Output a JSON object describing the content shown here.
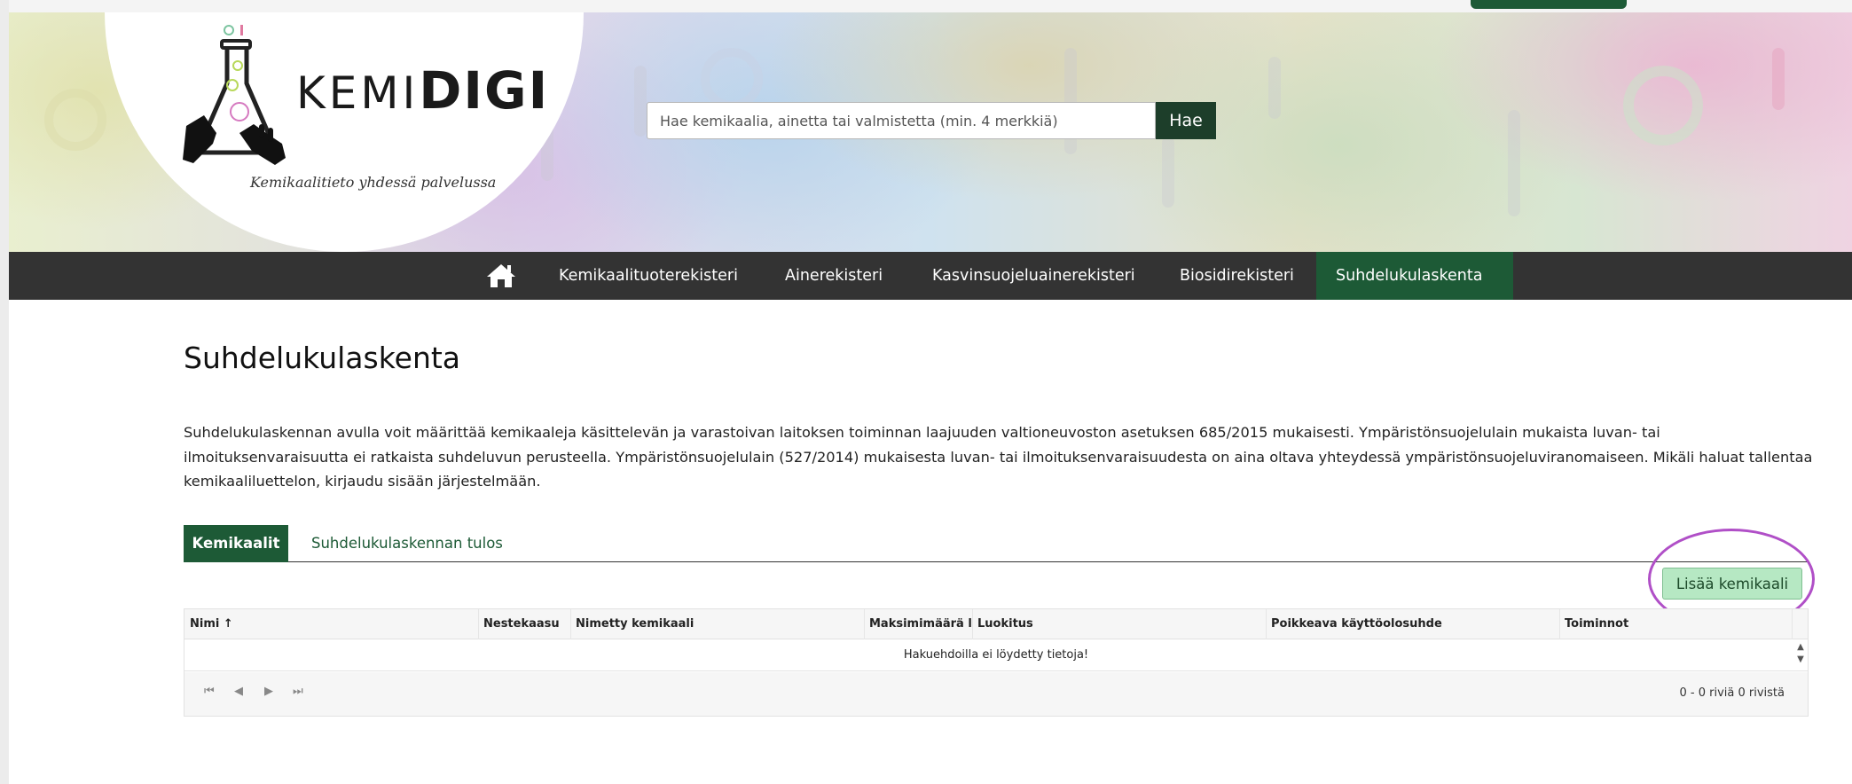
{
  "logo": {
    "word_thin": "KEMI",
    "word_bold": "DIGI",
    "tagline": "Kemikaalitieto yhdessä palvelussa"
  },
  "search": {
    "placeholder": "Hae kemikaalia, ainetta tai valmistetta (min. 4 merkkiä)",
    "button_label": "Hae"
  },
  "nav": {
    "home_icon": "home-icon",
    "items": [
      {
        "label": "Kemikaalituoterekisteri"
      },
      {
        "label": "Ainerekisteri"
      },
      {
        "label": "Kasvinsuojeluainerekisteri"
      },
      {
        "label": "Biosidirekisteri"
      },
      {
        "label": "Suhdelukulaskenta",
        "active": true
      }
    ]
  },
  "page": {
    "title": "Suhdelukulaskenta",
    "description": "Suhdelukulaskennan avulla voit määrittää kemikaaleja käsittelevän ja varastoivan laitoksen toiminnan laajuuden valtioneuvoston asetuksen 685/2015 mukaisesti. Ympäristönsuojelulain mukaista luvan- tai ilmoituksenvaraisuutta ei ratkaista suhdeluvun perusteella. Ympäristönsuojelulain (527/2014) mukaisesta luvan- tai ilmoituksenvaraisuudesta on aina oltava yhteydessä ympäristönsuojeluviranomaiseen. Mikäli haluat tallentaa kemikaaliluettelon, kirjaudu sisään järjestelmään."
  },
  "tabs": [
    {
      "label": "Kemikaalit",
      "active": true
    },
    {
      "label": "Suhdelukulaskennan tulos"
    }
  ],
  "add_button_label": "Lisää kemikaali",
  "grid": {
    "columns": [
      "Nimi ↑",
      "Nestekaasu",
      "Nimetty kemikaali",
      "Maksimimäärä l...",
      "Luokitus",
      "Poikkeava käyttöolosuhde",
      "Toiminnot"
    ],
    "empty_message": "Hakuehdoilla ei löydetty tietoja!",
    "pager_info": "0 - 0 riviä 0 rivistä",
    "pager_buttons": [
      "⏮",
      "◀",
      "▶",
      "⏭"
    ]
  },
  "colors": {
    "brand_green": "#1d5a36",
    "nav_bg": "#333333",
    "add_button_bg": "#b6e8c3",
    "highlight": "#b04fc7"
  }
}
